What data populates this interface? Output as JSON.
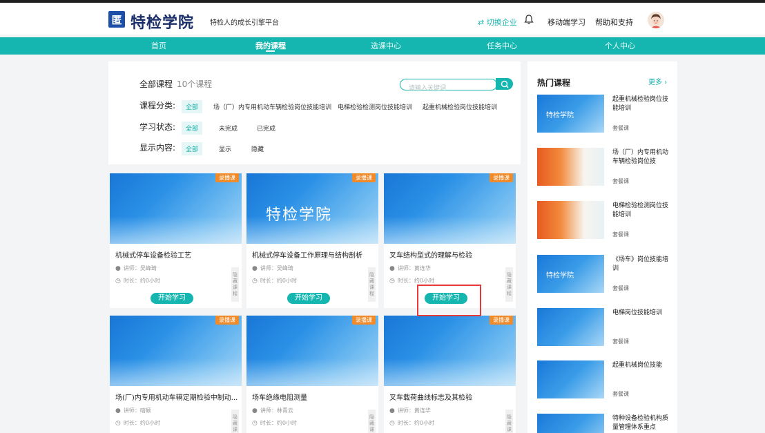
{
  "header": {
    "logo_mark": "匿",
    "logo_text": "特检学院",
    "slogan": "特检人的成长引擎平台",
    "switch_enterprise": "⇄ 切换企业",
    "mobile": "移动端学习",
    "help": "帮助和支持"
  },
  "nav": [
    "首页",
    "我的课程",
    "选课中心",
    "任务中心",
    "个人中心"
  ],
  "filters": {
    "all_courses": "全部课程",
    "count": "10个课程",
    "search_placeholder": "请输入关键词",
    "category_label": "课程分类:",
    "category_options": [
      "全部",
      "场（厂）内专用机动车辆检验岗位技能培训",
      "电梯检验检测岗位技能培训",
      "起重机械检验岗位技能培训"
    ],
    "status_label": "学习状态:",
    "status_options": [
      "全部",
      "未完成",
      "已完成"
    ],
    "display_label": "显示内容:",
    "display_options": [
      "全部",
      "显示",
      "隐藏"
    ]
  },
  "card_common": {
    "tag": "录播课",
    "start": "开始学习",
    "hide": "隐藏课程",
    "duration": "时长：约0小时",
    "brand": "特检学院"
  },
  "courses": [
    {
      "title": "机械式停车设备检验工艺",
      "lecturer": "讲师：吴峰琦"
    },
    {
      "title": "机械式停车设备工作原理与结构剖析",
      "lecturer": "讲师：吴峰琦"
    },
    {
      "title": "叉车结构型式的理解与检验",
      "lecturer": "讲师：黄连华"
    },
    {
      "title": "场(厂)内专用机动车辆定期检验中制动...",
      "lecturer": "讲师：暗颖"
    },
    {
      "title": "场车绝缘电阻测量",
      "lecturer": "讲师：林青云"
    },
    {
      "title": "叉车载荷曲线标志及其检验",
      "lecturer": "讲师：黄连华"
    }
  ],
  "hot": {
    "title": "热门课程",
    "more": "更多 ›",
    "items": [
      {
        "name": "起重机械检验岗位技能培训",
        "type": "套餐课"
      },
      {
        "name": "场（厂）内专用机动车辆检验岗位技",
        "type": "套餐课"
      },
      {
        "name": "电梯检验检测岗位技能培训",
        "type": "套餐课"
      },
      {
        "name": "《场车》岗位技能培训",
        "type": "套餐课"
      },
      {
        "name": "电梯岗位技能培训",
        "type": "套餐课"
      },
      {
        "name": "起重机械岗位技能",
        "type": "套餐课"
      },
      {
        "name": "特种设备检验机构质量管理体系重点",
        "type": ""
      }
    ]
  },
  "colors": {
    "teal": "#16b6b0",
    "tag_orange": "#f18b2a",
    "highlight_red": "#e43a3a"
  }
}
